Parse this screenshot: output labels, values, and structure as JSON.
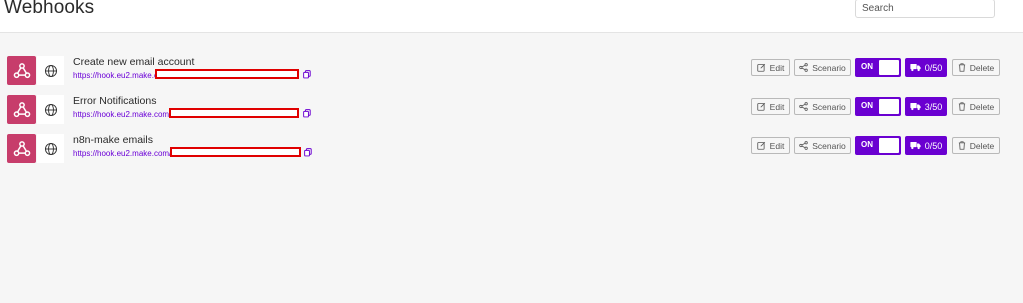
{
  "header": {
    "title": "Webhooks",
    "search_placeholder": "Search"
  },
  "actions": {
    "edit_label": "Edit",
    "scenario_label": "Scenario",
    "toggle_label": "ON",
    "delete_label": "Delete"
  },
  "webhooks": [
    {
      "name": "Create new email account",
      "url": "https://hook.eu2.make.c",
      "ops": "0/50"
    },
    {
      "name": "Error Notifications",
      "url": "https://hook.eu2.make.com/",
      "ops": "3/50"
    },
    {
      "name": "n8n-make emails",
      "url": "https://hook.eu2.make.com/",
      "ops": "0/50"
    }
  ],
  "colors": {
    "accent": "#6a00d1",
    "webhook_icon_bg": "#c73d6b",
    "redaction": "#e00000"
  },
  "icons": {
    "webhook": "webhook-icon",
    "type": "globe-icon",
    "copy": "copy-icon",
    "edit": "edit-icon",
    "scenario": "share-icon",
    "operations": "truck-icon",
    "delete": "trash-icon"
  }
}
